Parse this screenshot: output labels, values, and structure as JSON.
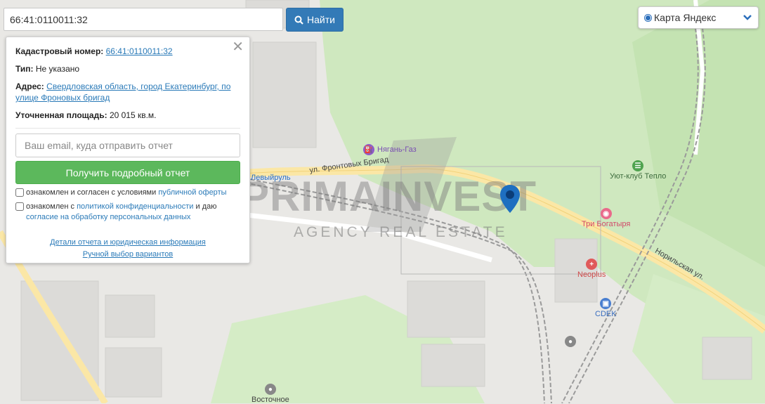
{
  "search": {
    "value": "66:41:0110011:32",
    "button_label": "Найти"
  },
  "layer_select": {
    "selected": "Карта Яндекс"
  },
  "panel": {
    "cadastral_label": "Кадастровый номер:",
    "cadastral_value": "66:41:0110011:32",
    "type_label": "Тип:",
    "type_value": "Не указано",
    "address_label": "Адрес:",
    "address_value": "Свердловская область, город Екатеринбург, по улице Фроновых бригад",
    "area_label": "Уточненная площадь:",
    "area_value": "20 015 кв.м.",
    "email_placeholder": "Ваш email, куда отправить отчет",
    "report_button": "Получить подробный отчет",
    "consent1_text": "ознакомлен и согласен с условиями",
    "consent1_link": "публичной оферты",
    "consent2_text1": "ознакомлен с",
    "consent2_link1": "политикой конфиденциальности",
    "consent2_text2": "и даю",
    "consent2_link2": "согласие на обработку персональных данных",
    "details_link": "Детали отчета и юридическая информация",
    "manual_link": "Ручной выбор вариантов"
  },
  "map": {
    "street_frontovykh": "ул. Фронтовых Бригад",
    "street_norilskaya": "Норильская ул.",
    "poi_nyagan": "Нягань-Газ",
    "poi_yut": "Уют-клуб Тепло",
    "poi_tri": "Три Богатыря",
    "poi_neoplus": "Neoplus",
    "poi_cdek": "CDEK",
    "poi_vostochnoe": "Восточное",
    "poi_rul": "Левыйруль",
    "colors": {
      "forest": "#cfe8bf",
      "road": "#fbe7a6",
      "railway": "#9a9a9a",
      "marker": "#1e6fc0"
    }
  },
  "watermark": {
    "title": "PRIMAINVEST",
    "subtitle": "AGENCY REAL ESTATE"
  }
}
